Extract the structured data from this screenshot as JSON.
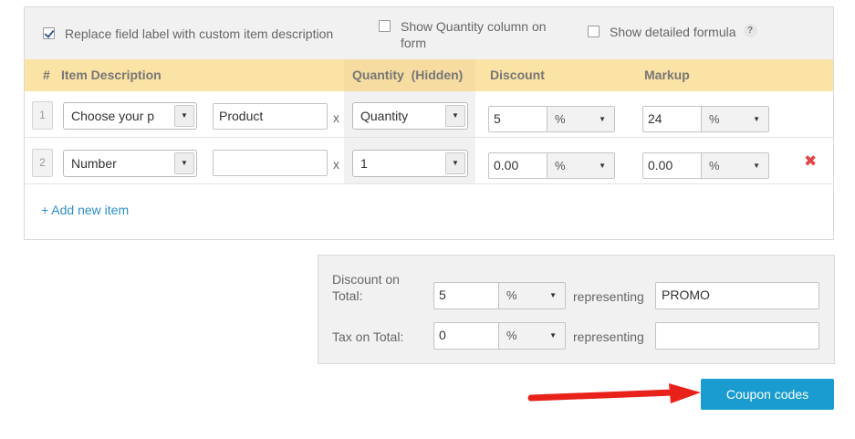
{
  "options": {
    "replace_label": {
      "text": "Replace field label with custom item description",
      "checked": true
    },
    "show_quantity": {
      "text_line1": "Show Quantity column on",
      "text_line2": "form",
      "checked": false
    },
    "show_formula": {
      "text": "Show detailed formula",
      "checked": false,
      "help": "?"
    }
  },
  "table": {
    "headers": {
      "num": "#",
      "description": "Item Description",
      "quantity": "Quantity",
      "quantity_note": "(Hidden)",
      "discount": "Discount",
      "markup": "Markup"
    },
    "multiply": "x",
    "rows": [
      {
        "num": "1",
        "type": "Choose your p",
        "description": "Product",
        "quantity": "Quantity",
        "discount": "5",
        "discount_unit": "%",
        "markup": "24",
        "markup_unit": "%"
      },
      {
        "num": "2",
        "type": "Number",
        "description": "",
        "quantity": "1",
        "discount": "0.00",
        "discount_unit": "%",
        "markup": "0.00",
        "markup_unit": "%"
      }
    ]
  },
  "add_item_label": "+ Add new item",
  "totals": {
    "discount_label_line1": "Discount on",
    "discount_label_line2": "Total:",
    "discount_value": "5",
    "discount_unit": "%",
    "representing": "representing",
    "discount_code": "PROMO",
    "tax_label": "Tax on Total:",
    "tax_value": "0",
    "tax_unit": "%",
    "tax_code": ""
  },
  "coupon_button": "Coupon codes",
  "colors": {
    "header": "#fbe2a5",
    "button": "#1a9cd1",
    "arrow": "#e8221b",
    "link": "#2c8ec9"
  }
}
